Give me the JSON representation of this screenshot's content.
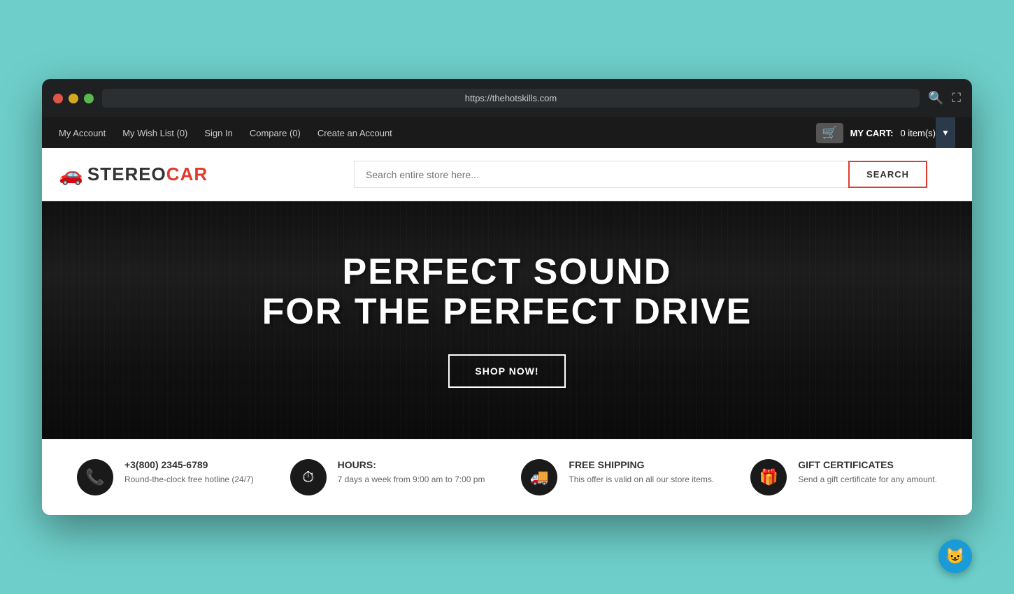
{
  "browser": {
    "url": "https://thehotskills.com",
    "traffic_lights": [
      "red",
      "yellow",
      "green"
    ]
  },
  "top_nav": {
    "links": [
      {
        "label": "My Account",
        "id": "my-account"
      },
      {
        "label": "My Wish List (0)",
        "id": "wish-list"
      },
      {
        "label": "Sign In",
        "id": "sign-in"
      },
      {
        "label": "Compare (0)",
        "id": "compare"
      },
      {
        "label": "Create an Account",
        "id": "create-account"
      }
    ],
    "cart": {
      "label": "MY CART:",
      "count": "0 item(s)"
    }
  },
  "header": {
    "logo": {
      "stereo": "STEREO",
      "car": "CAR",
      "icon": "🚗"
    },
    "search": {
      "placeholder": "Search entire store here...",
      "button_label": "SEARCH"
    }
  },
  "hero": {
    "title_line1": "PERFECT SOUND",
    "title_line2": "FOR THE PERFECT DRIVE",
    "cta_label": "SHOP NOW!"
  },
  "features": [
    {
      "icon": "📞",
      "title": "+3(800) 2345-6789",
      "description": "Round-the-clock free hotline (24/7)"
    },
    {
      "icon": "⏱",
      "title": "HOURS:",
      "description": "7 days a week from 9:00 am to 7:00 pm"
    },
    {
      "icon": "🚚",
      "title": "FREE SHIPPING",
      "description": "This offer is valid on all our store items."
    },
    {
      "icon": "🎁",
      "title": "GIFT CERTIFICATES",
      "description": "Send a gift certificate for any amount."
    }
  ],
  "chat": {
    "icon": "😺"
  }
}
